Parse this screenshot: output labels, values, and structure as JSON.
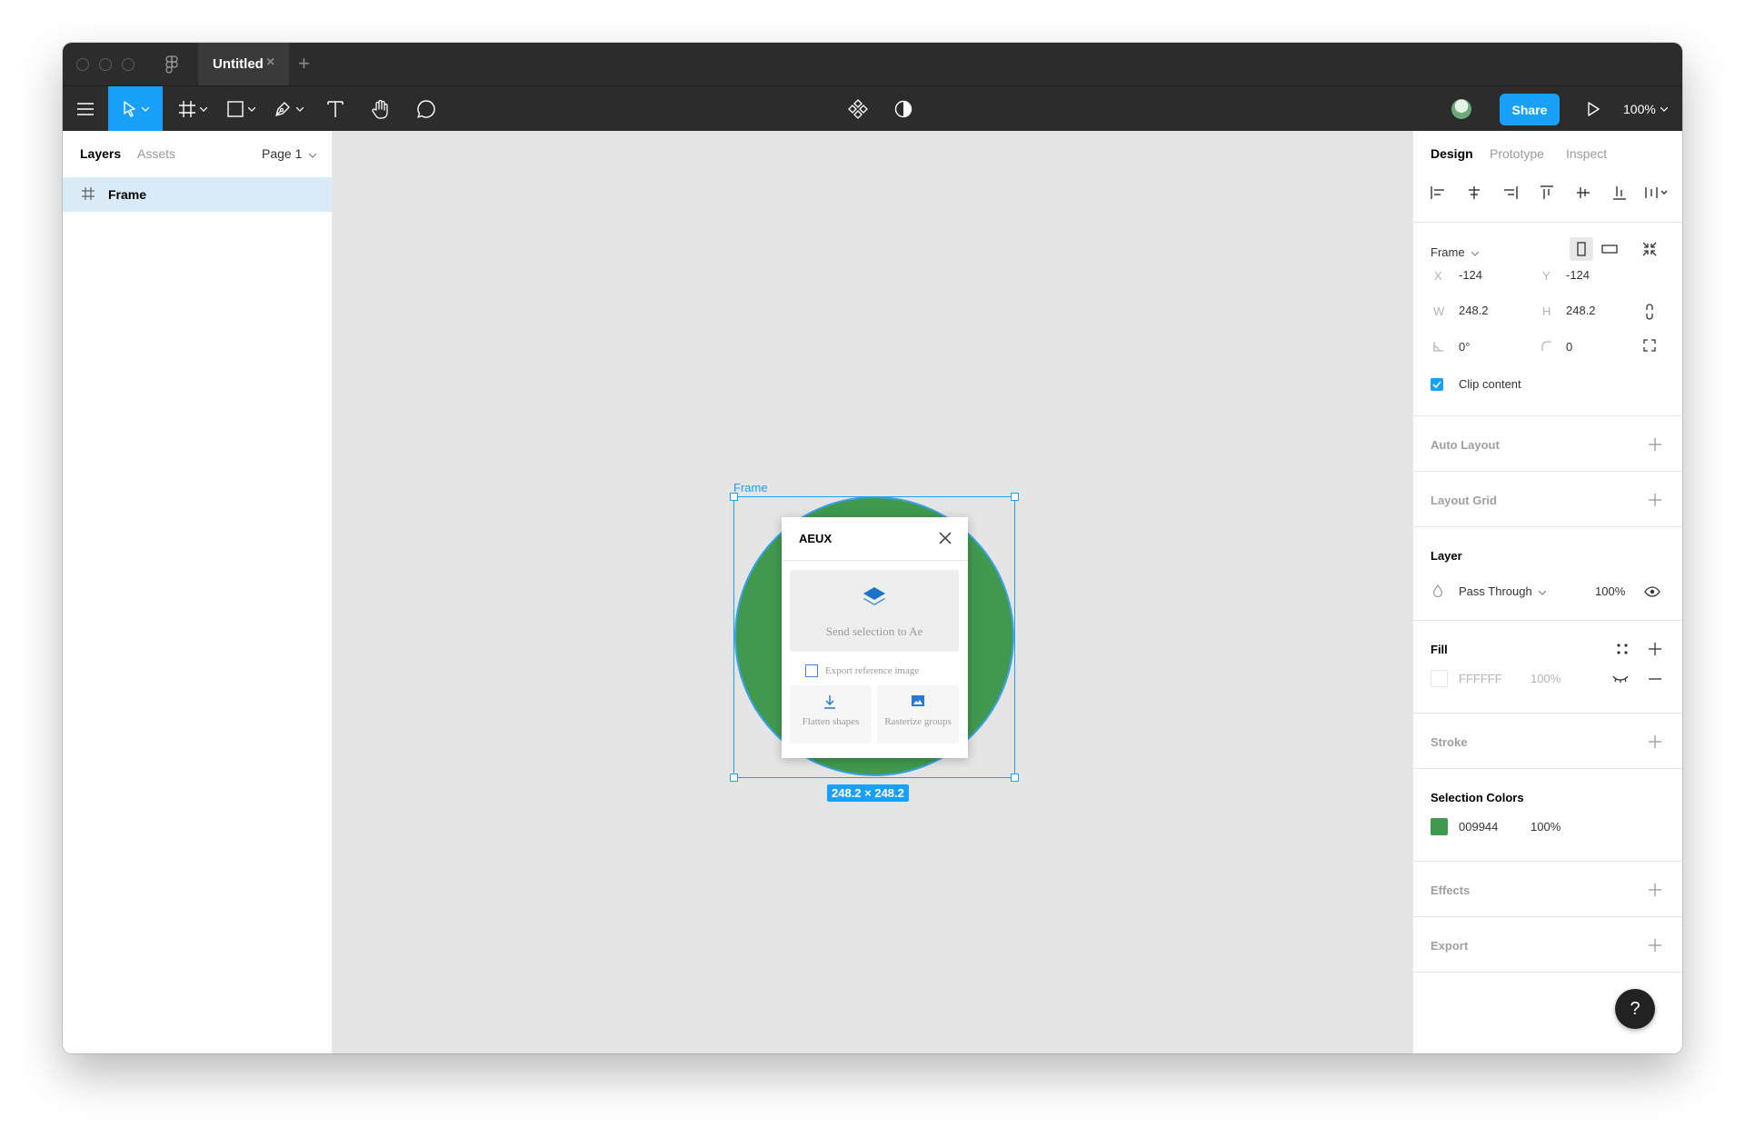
{
  "titlebar": {
    "tab_title": "Untitled",
    "tab_close": "×",
    "tab_add": "+"
  },
  "toolbar": {
    "share_label": "Share",
    "zoom_label": "100%"
  },
  "left_panel": {
    "tabs": [
      "Layers",
      "Assets"
    ],
    "page_selector": "Page 1",
    "layers": [
      {
        "name": "Frame",
        "icon": "frame-icon"
      }
    ]
  },
  "canvas": {
    "frame_label": "Frame",
    "dimensions_badge": "248.2 × 248.2",
    "circle_color": "#41994f",
    "plugin": {
      "title": "AEUX",
      "send_label": "Send selection to Ae",
      "export_label": "Export reference image",
      "flatten_label": "Flatten shapes",
      "rasterize_label": "Rasterize groups"
    }
  },
  "right_panel": {
    "tabs": [
      "Design",
      "Prototype",
      "Inspect"
    ],
    "frame_selector": "Frame",
    "x_label": "X",
    "x_value": "-124",
    "y_label": "Y",
    "y_value": "-124",
    "w_label": "W",
    "w_value": "248.2",
    "h_label": "H",
    "h_value": "248.2",
    "rotation_value": "0°",
    "radius_value": "0",
    "clip_content_label": "Clip content",
    "auto_layout_title": "Auto Layout",
    "layout_grid_title": "Layout Grid",
    "layer_title": "Layer",
    "blend_mode": "Pass Through",
    "layer_opacity": "100%",
    "fill_title": "Fill",
    "fill_hex": "FFFFFF",
    "fill_opacity": "100%",
    "stroke_title": "Stroke",
    "selection_colors_title": "Selection Colors",
    "selection_color_hex": "009944",
    "selection_color_opacity": "100%",
    "selection_color_swatch": "#41994f",
    "effects_title": "Effects",
    "export_title": "Export",
    "help_label": "?"
  },
  "colors": {
    "accent": "#18a0fb",
    "chrome": "#2c2c2c"
  }
}
